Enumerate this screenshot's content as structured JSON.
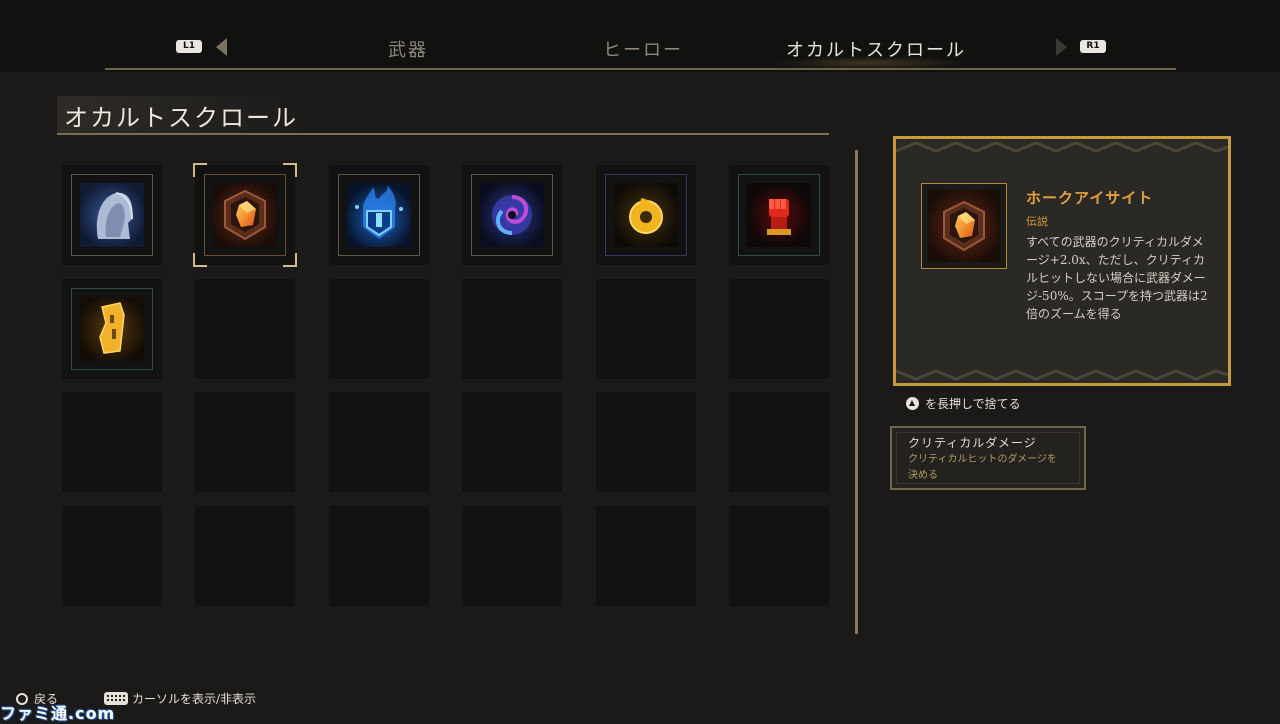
{
  "topnav": {
    "left_button": "L1",
    "right_button": "R1",
    "tabs": [
      {
        "label": "武器"
      },
      {
        "label": "ヒーロー"
      },
      {
        "label": "オカルトスクロール"
      }
    ]
  },
  "page": {
    "title": "オカルトスクロール"
  },
  "inventory": {
    "items": [
      {
        "icon": "hood-icon"
      },
      {
        "icon": "amber-gem-icon",
        "selected": true
      },
      {
        "icon": "blue-shield-flame-icon"
      },
      {
        "icon": "vortex-icon"
      },
      {
        "icon": "gold-ring-icon"
      },
      {
        "icon": "red-fist-icon"
      },
      {
        "icon": "gold-bracer-icon"
      }
    ]
  },
  "detail": {
    "name": "ホークアイサイト",
    "rarity": "伝説",
    "description": "すべての武器のクリティカルダメージ+2.0x、ただし、クリティカルヒットしない場合に武器ダメージ-50%。スコープを持つ武器は2倍のズームを得る",
    "colors": {
      "accent": "#c59b3c",
      "rarity": "#d79a37"
    }
  },
  "discard_hint": "を長押しで捨てる",
  "tooltip": {
    "title": "クリティカルダメージ",
    "description": "クリティカルヒットのダメージを決める"
  },
  "footer": {
    "back": "戻る",
    "cursor_toggle": "カーソルを表示/非表示"
  },
  "watermark": "ファミ通.com"
}
